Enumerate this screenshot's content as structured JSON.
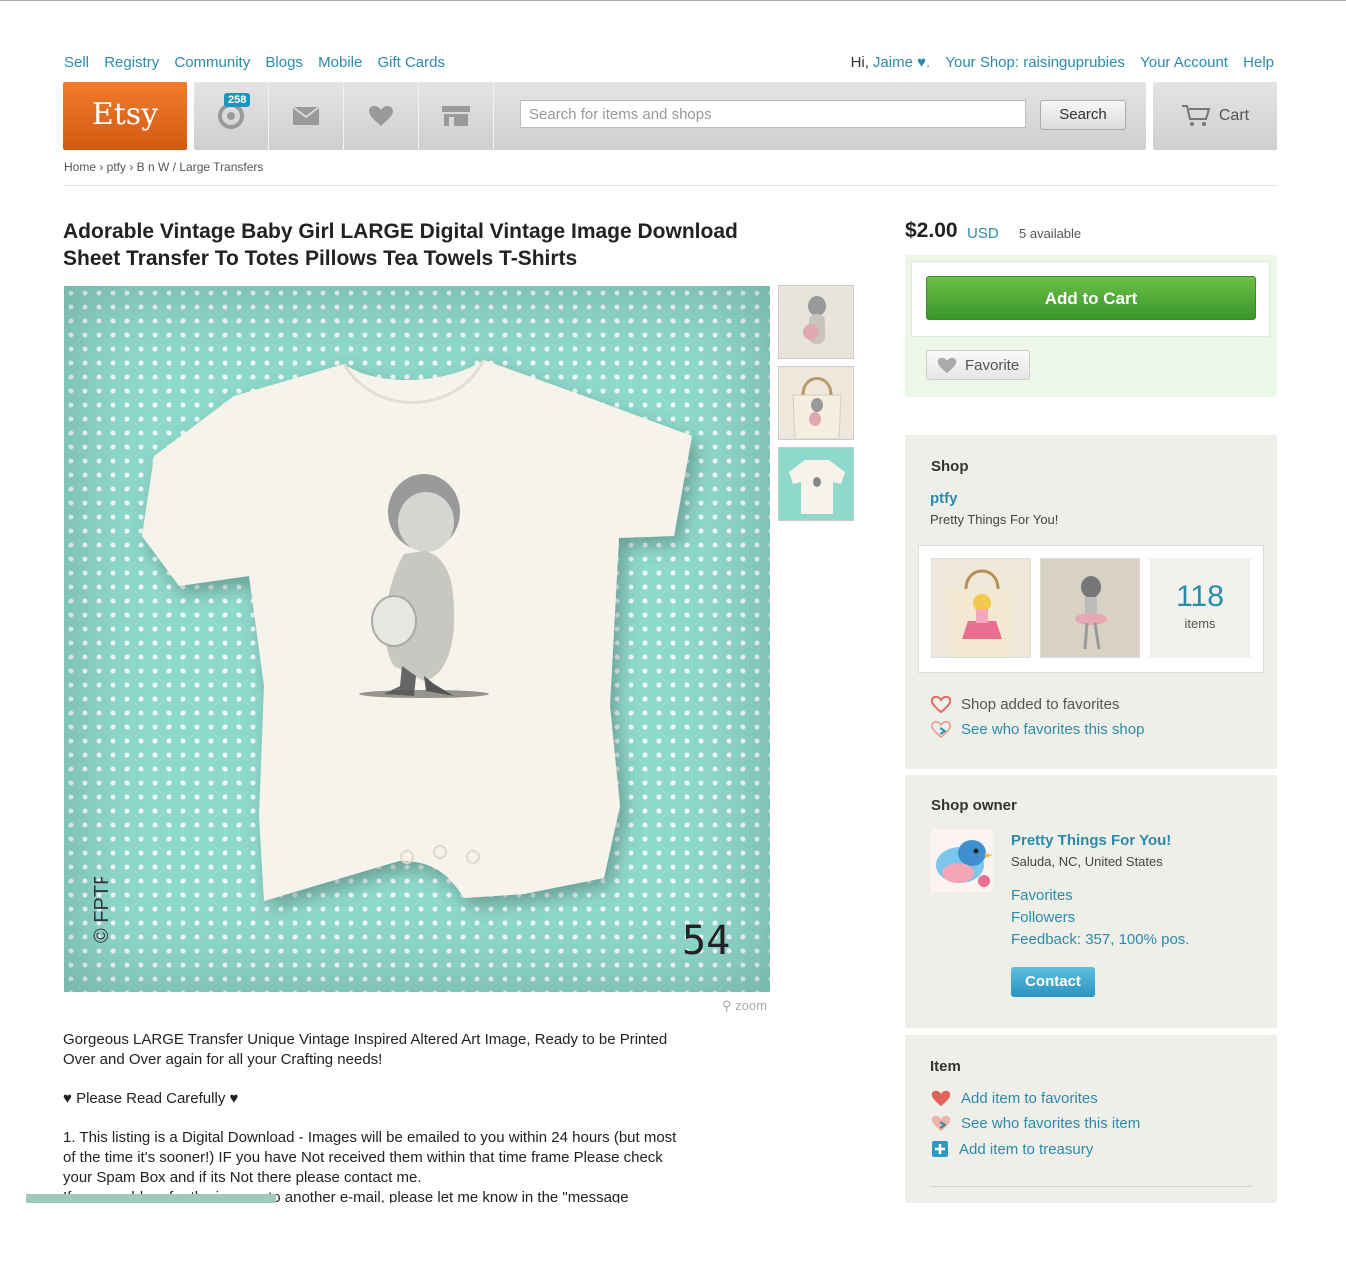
{
  "top_nav": {
    "links": [
      "Sell",
      "Registry",
      "Community",
      "Blogs",
      "Mobile",
      "Gift Cards"
    ],
    "greeting": "Hi,",
    "user": "Jaime ♥.",
    "your_shop": "Your Shop: raisinguprubies",
    "your_account": "Your Account",
    "help": "Help"
  },
  "header": {
    "logo": "Etsy",
    "activity_count": "258",
    "search_placeholder": "Search for items and shops",
    "search_button": "Search",
    "cart_label": "Cart"
  },
  "breadcrumb": "Home › ptfy › B n W / Large Transfers",
  "listing": {
    "title": "Adorable Vintage Baby Girl LARGE Digital Vintage Image Download Sheet Transfer To Totes Pillows Tea Towels T-Shirts",
    "image_number": "54",
    "watermark": "© FPTFY",
    "zoom_label": "zoom",
    "description": [
      "Gorgeous LARGE Transfer Unique Vintage Inspired Altered Art Image, Ready to be Printed Over and Over again for all your Crafting needs!",
      "♥ Please Read Carefully ♥",
      "1. This listing is a Digital Download - Images will be emailed to you within 24 hours (but most of the time it's sooner!) IF you have Not received them within that time frame Please check your Spam Box and if its Not there please contact me.",
      "If you would prefer the images to another e-mail, please let me know in the \"message"
    ]
  },
  "purchase": {
    "price": "$2.00",
    "currency": "USD",
    "available": "5 available",
    "add_to_cart": "Add to Cart",
    "favorite": "Favorite"
  },
  "shop": {
    "heading": "Shop",
    "name": "ptfy",
    "tagline": "Pretty Things For You!",
    "items_count": "118",
    "items_label": "items",
    "added_to_favorites": "Shop added to favorites",
    "see_who_favorites": "See who favorites this shop"
  },
  "owner": {
    "heading": "Shop owner",
    "name": "Pretty Things For You!",
    "location": "Saluda, NC, United States",
    "favorites": "Favorites",
    "followers": "Followers",
    "feedback": "Feedback: 357, 100% pos.",
    "contact": "Contact"
  },
  "item": {
    "heading": "Item",
    "add_favorites": "Add item to favorites",
    "see_who_favorites": "See who favorites this item",
    "add_treasury": "Add item to treasury"
  },
  "colors": {
    "etsy_orange": "#e2661a",
    "link_blue": "#2b8bab",
    "cart_green": "#4caf34",
    "mint_background": "#8fd8cc"
  }
}
